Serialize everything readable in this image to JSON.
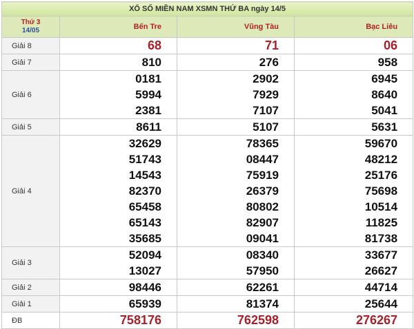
{
  "title": "XỔ SỐ MIỀN NAM XSMN THỨ BA ngày 14/5",
  "day": {
    "weekday": "Thứ 3",
    "date": "14/05"
  },
  "provinces": [
    "Bến Tre",
    "Vũng Tàu",
    "Bạc Liêu"
  ],
  "prizes": [
    {
      "label": "Giải 8",
      "values": [
        [
          "68"
        ],
        [
          "71"
        ],
        [
          "06"
        ]
      ]
    },
    {
      "label": "Giải 7",
      "values": [
        [
          "810"
        ],
        [
          "276"
        ],
        [
          "958"
        ]
      ]
    },
    {
      "label": "Giải 6",
      "values": [
        [
          "0181",
          "5994",
          "2381"
        ],
        [
          "2902",
          "7929",
          "7107"
        ],
        [
          "6945",
          "8640",
          "5041"
        ]
      ]
    },
    {
      "label": "Giải 5",
      "values": [
        [
          "8611"
        ],
        [
          "5107"
        ],
        [
          "5631"
        ]
      ]
    },
    {
      "label": "Giải 4",
      "values": [
        [
          "32629",
          "51743",
          "14543",
          "82370",
          "65458",
          "65143",
          "35685"
        ],
        [
          "78365",
          "08447",
          "75919",
          "26379",
          "80802",
          "82907",
          "09041"
        ],
        [
          "59670",
          "48212",
          "25176",
          "75698",
          "10514",
          "11825",
          "81738"
        ]
      ]
    },
    {
      "label": "Giải 3",
      "values": [
        [
          "52094",
          "13027"
        ],
        [
          "08340",
          "57950"
        ],
        [
          "33677",
          "26627"
        ]
      ]
    },
    {
      "label": "Giải 2",
      "values": [
        [
          "98446"
        ],
        [
          "62261"
        ],
        [
          "44714"
        ]
      ]
    },
    {
      "label": "Giải 1",
      "values": [
        [
          "65939"
        ],
        [
          "81374"
        ],
        [
          "25644"
        ]
      ]
    },
    {
      "label": "ĐB",
      "values": [
        [
          "758176"
        ],
        [
          "762598"
        ],
        [
          "276267"
        ]
      ]
    }
  ]
}
